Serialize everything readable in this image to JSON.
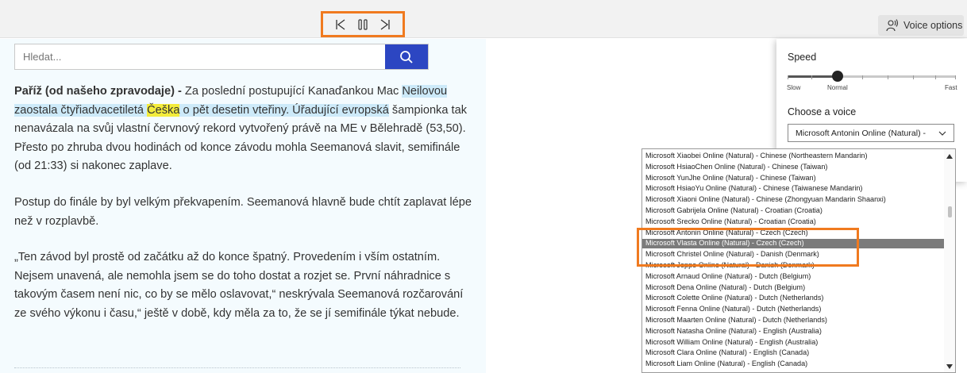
{
  "toolbar": {
    "voice_options_label": "Voice options",
    "icons": {
      "previous": "skip-previous-icon",
      "pause": "pause-icon",
      "next": "skip-next-icon",
      "voice": "voice-icon"
    }
  },
  "search": {
    "placeholder": "Hledat...",
    "icon": "search-icon"
  },
  "article": {
    "p1_bold": "Paříž (od našeho zpravodaje) -",
    "p1_text": " Za poslední postupující Kanaďankou Mac ",
    "p1_hl_a": "Neilovou zaostala čtyřiadvacetiletá ",
    "p1_hl_word": "Češka",
    "p1_hl_b": " o pět desetin vteřiny. Úřadující evropská",
    "p1_rest": " šampionka tak nenavázala na svůj vlastní červnový rekord vytvořený právě na ME v Bělehradě (53,50). Přesto po zhruba dvou hodinách od konce závodu mohla Seemanová slavit, semifinále (od 21:33) si nakonec zaplave.",
    "p2": "Postup do finále by byl velkým překvapením. Seemanová hlavně bude chtít zaplavat lépe než v rozplavbě.",
    "p3": "„Ten závod byl prostě od začátku až do konce špatný. Provedením i vším ostatním. Nejsem unavená, ale nemohla jsem se do toho dostat a rozjet se. První náhradnice s takovým časem není nic, co by se mělo oslavovat,“ neskrývala Seemanová rozčarování ze svého výkonu i času,“ ještě v době, kdy měla za to, že se jí semifinále týkat nebude."
  },
  "voice_panel": {
    "speed_label": "Speed",
    "speed_value": "Normal",
    "speed_level": 0.25,
    "slow_label": "Slow",
    "normal_label": "Normal",
    "fast_label": "Fast",
    "choose_voice_label": "Choose a voice",
    "selected_voice": "Microsoft Antonin Online (Natural) -"
  },
  "voice_list": [
    "Microsoft Xiaobei Online (Natural) - Chinese (Northeastern Mandarin)",
    "Microsoft HsiaoChen Online (Natural) - Chinese (Taiwan)",
    "Microsoft YunJhe Online (Natural) - Chinese (Taiwan)",
    "Microsoft HsiaoYu Online (Natural) - Chinese (Taiwanese Mandarin)",
    "Microsoft Xiaoni Online (Natural) - Chinese (Zhongyuan Mandarin Shaanxi)",
    "Microsoft Gabrijela Online (Natural) - Croatian (Croatia)",
    "Microsoft Srecko Online (Natural) - Croatian (Croatia)",
    "Microsoft Antonin Online (Natural) - Czech (Czech)",
    "Microsoft Vlasta Online (Natural) - Czech (Czech)",
    "Microsoft Christel Online (Natural) - Danish (Denmark)",
    "Microsoft Jeppe Online (Natural) - Danish (Denmark)",
    "Microsoft Arnaud Online (Natural) - Dutch (Belgium)",
    "Microsoft Dena Online (Natural) - Dutch (Belgium)",
    "Microsoft Colette Online (Natural) - Dutch (Netherlands)",
    "Microsoft Fenna Online (Natural) - Dutch (Netherlands)",
    "Microsoft Maarten Online (Natural) - Dutch (Netherlands)",
    "Microsoft Natasha Online (Natural) - English (Australia)",
    "Microsoft William Online (Natural) - English (Australia)",
    "Microsoft Clara Online (Natural) - English (Canada)",
    "Microsoft Liam Online (Natural) - English (Canada)"
  ],
  "voice_list_highlighted_index": 8,
  "colors": {
    "accent": "#2c46c2",
    "highlight_box": "#f07a1f",
    "sentence_highlight": "#cdeaf9",
    "word_highlight": "#f3ec3b"
  }
}
